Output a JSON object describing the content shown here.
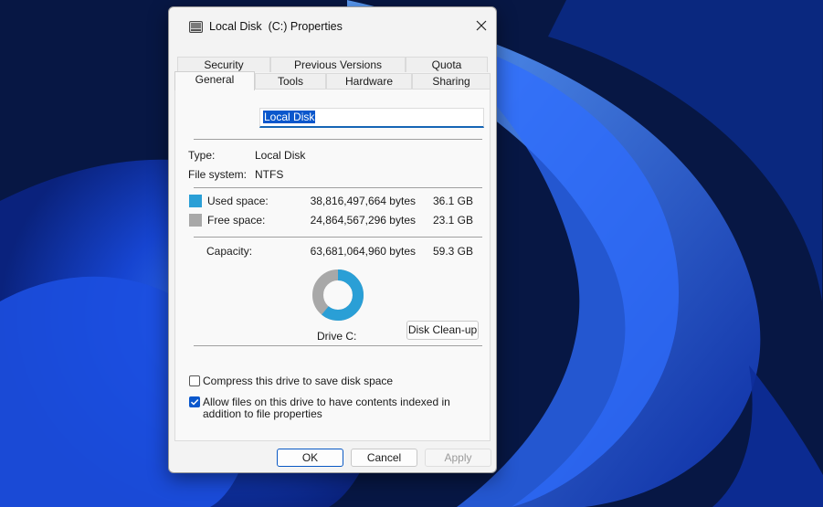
{
  "window": {
    "title": "Local Disk  (C:) Properties"
  },
  "tabs": {
    "row1": [
      {
        "label": "Security"
      },
      {
        "label": "Previous Versions"
      },
      {
        "label": "Quota"
      }
    ],
    "row2": [
      {
        "label": "General",
        "active": true
      },
      {
        "label": "Tools"
      },
      {
        "label": "Hardware"
      },
      {
        "label": "Sharing"
      }
    ]
  },
  "general": {
    "name_value": "Local Disk",
    "type_label": "Type:",
    "type_value": "Local Disk",
    "fs_label": "File system:",
    "fs_value": "NTFS",
    "used": {
      "label": "Used space:",
      "bytes": "38,816,497,664 bytes",
      "size": "36.1 GB",
      "color": "#2a9fd6",
      "fraction": 0.6096
    },
    "free": {
      "label": "Free space:",
      "bytes": "24,864,567,296 bytes",
      "size": "23.1 GB",
      "color": "#a8a8a8"
    },
    "capacity": {
      "label": "Capacity:",
      "bytes": "63,681,064,960 bytes",
      "size": "59.3 GB"
    },
    "drive_label": "Drive C:",
    "cleanup_button": "Disk Clean-up",
    "compress_label": "Compress this drive to save disk space",
    "compress_checked": false,
    "index_label": "Allow files on this drive to have contents indexed in addition to file properties",
    "index_checked": true
  },
  "buttons": {
    "ok": "OK",
    "cancel": "Cancel",
    "apply": "Apply"
  },
  "icons": {
    "title": "drive-icon",
    "close": "close-icon",
    "check": "checkmark-icon"
  }
}
